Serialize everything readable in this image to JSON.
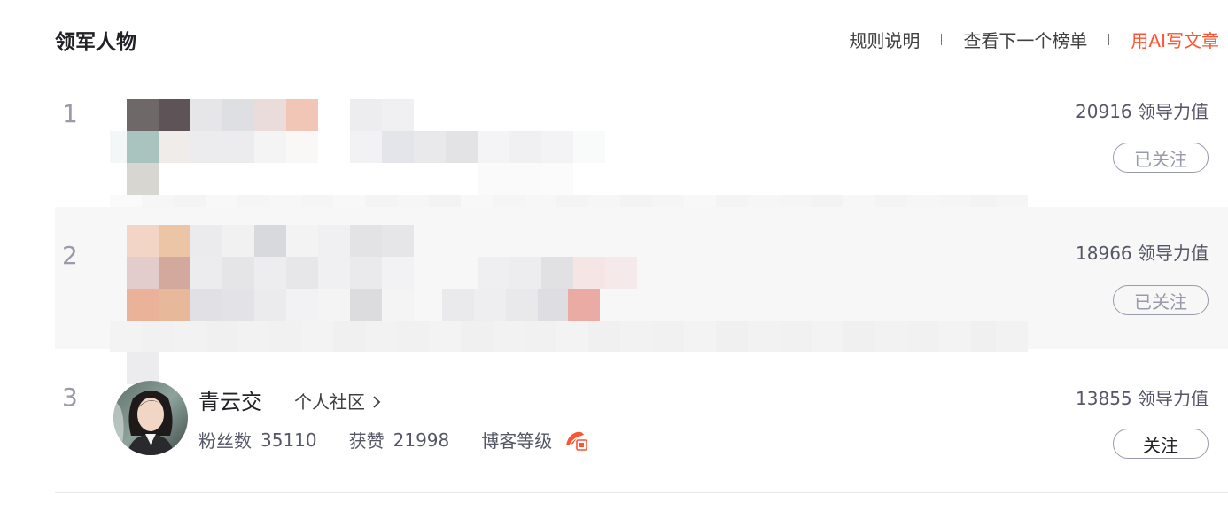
{
  "header": {
    "title": "领军人物",
    "rules_label": "规则说明",
    "next_list_label": "查看下一个榜单",
    "ai_write_label": "用AI写文章"
  },
  "rows": [
    {
      "rank": "1",
      "score_label": "20916 领导力值",
      "follow_label": "已关注"
    },
    {
      "rank": "2",
      "score_label": "18966 领导力值",
      "follow_label": "已关注"
    },
    {
      "rank": "3",
      "name": "青云交",
      "community_label": "个人社区",
      "fans_label": "粉丝数",
      "fans_value": "35110",
      "likes_label": "获赞",
      "likes_value": "21998",
      "level_label": "博客等级",
      "score_label": "13855 领导力值",
      "follow_label": "关注"
    }
  ]
}
